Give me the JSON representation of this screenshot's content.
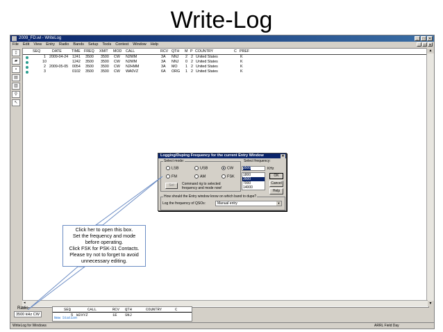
{
  "slide": {
    "title": "Write-Log"
  },
  "window": {
    "title": "2009_FD.wl - WriteLog",
    "menu": [
      "File",
      "Edit",
      "View",
      "Entry",
      "Radio",
      "Bands",
      "Setup",
      "Tools",
      "Contest",
      "Window",
      "Help"
    ]
  },
  "log": {
    "columns": [
      "SEQ",
      "DATE",
      "TIME",
      "FREQ",
      "XMIT",
      "MOD",
      "CALL",
      "RCV",
      "QTH",
      "M",
      "P",
      "COUNTRY",
      "C",
      "PREF"
    ],
    "rows": [
      {
        "seq": "1",
        "date": "2009-04-24",
        "time": "1241",
        "freq": "3500",
        "xmit": "3500",
        "mod": "CW",
        "call": "N2WM",
        "rcv": "3A",
        "qth": "NNJ",
        "m": "2",
        "p": "2",
        "country": "United States",
        "pref": "K"
      },
      {
        "seq": "10",
        "date": "",
        "time": "1242",
        "freq": "3500",
        "xmit": "3500",
        "mod": "CW",
        "call": "N2WM",
        "rcv": "3A",
        "qth": "NNJ",
        "m": "0",
        "p": "2",
        "country": "United States",
        "pref": "K"
      },
      {
        "seq": "2",
        "date": "2009-05-05",
        "time": "0054",
        "freq": "3500",
        "xmit": "3500",
        "mod": "CW",
        "call": "N2HMM",
        "rcv": "3A",
        "qth": "MO",
        "m": "1",
        "p": "2",
        "country": "United States",
        "pref": "K"
      },
      {
        "seq": "3",
        "date": "",
        "time": "0102",
        "freq": "3500",
        "xmit": "3500",
        "mod": "CW",
        "call": "WA0VZ",
        "rcv": "6A",
        "qth": "ORG",
        "m": "1",
        "p": "2",
        "country": "United States",
        "pref": "K"
      }
    ]
  },
  "entry": {
    "headers": [
      "SEQ",
      "CALL",
      "RCV",
      "QTH",
      "COUNTRY",
      "C"
    ],
    "seq": "5",
    "call": "W2XYZ",
    "rcv": "1E",
    "qth": "SNJ",
    "status": "New Station"
  },
  "radio": {
    "label": "Radio",
    "value": "3500 kHz CW"
  },
  "statusbar": {
    "left": "WriteLog for Windows",
    "right": "ARRL Field Day"
  },
  "dialog": {
    "title": "Logging/Duping Frequency for the current Entry Window",
    "select_mode_label": "Select mode:",
    "modes": [
      "LSB",
      "USB",
      "CW",
      "FM",
      "AM",
      "FSK"
    ],
    "selected_mode": "CW",
    "set_button": "Set",
    "command_text_1": "Command rig to selected",
    "command_text_2": "frequency and mode now!",
    "select_freq_label": "Select frequency:",
    "freq_value": "3500",
    "freq_unit": "KHz",
    "freq_options": [
      "1800",
      "3500",
      "7000",
      "14000"
    ],
    "selected_freq": "3500",
    "ok_button": "OK",
    "cancel_button": "Cancel",
    "help_button": "Help",
    "band_question": "How should the Entry window know on which band to dupe?",
    "log_freq_label": "Log the frequency of QSOs:",
    "log_freq_value": "Manual entry"
  },
  "callout": {
    "lines": [
      "Click her to open this box.",
      "Set the frequency and mode",
      "before operating.",
      "Click FSK for PSK-31 Contacts.",
      "Please try not to forget to avoid",
      "unnecessary editing."
    ]
  },
  "colors": {
    "titlebar": "#0a246a",
    "app_bg": "#d4d0c8",
    "row_icon": "#2a9d8f",
    "status_text": "#1a6fd0",
    "callout_border": "#6b8cc4"
  }
}
